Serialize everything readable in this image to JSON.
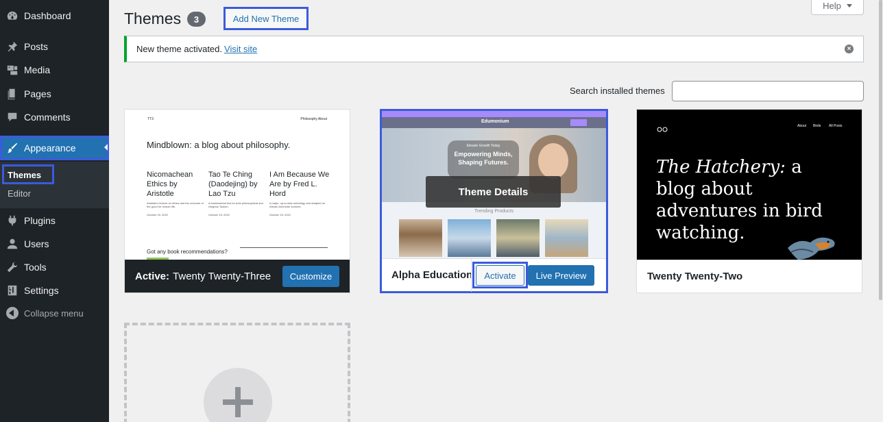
{
  "sidebar": {
    "items": [
      {
        "label": "Dashboard",
        "icon": "dashboard-icon"
      },
      {
        "label": "Posts",
        "icon": "pin-icon"
      },
      {
        "label": "Media",
        "icon": "media-icon"
      },
      {
        "label": "Pages",
        "icon": "pages-icon"
      },
      {
        "label": "Comments",
        "icon": "comment-icon"
      },
      {
        "label": "Appearance",
        "icon": "brush-icon"
      },
      {
        "label": "Plugins",
        "icon": "plug-icon"
      },
      {
        "label": "Users",
        "icon": "user-icon"
      },
      {
        "label": "Tools",
        "icon": "wrench-icon"
      },
      {
        "label": "Settings",
        "icon": "settings-icon"
      }
    ],
    "submenu": {
      "themes": "Themes",
      "editor": "Editor"
    },
    "collapse": "Collapse menu"
  },
  "header": {
    "title": "Themes",
    "count": "3",
    "add_new": "Add New Theme",
    "help": "Help"
  },
  "notice": {
    "text": "New theme activated.",
    "link": "Visit site"
  },
  "search": {
    "label": "Search installed themes",
    "value": ""
  },
  "themes": [
    {
      "name": "Twenty Twenty-Three",
      "active_label": "Active:",
      "action": "Customize",
      "preview": {
        "site": "TT3",
        "nav": "Philosophy  About",
        "headline": "Mindblown: a blog about philosophy.",
        "posts": [
          {
            "title": "Nicomachean Ethics by Aristotle",
            "excerpt": "Aristotle's lecture on ethics and the outcome of the good for human life.",
            "date": "October 15, 2022"
          },
          {
            "title": "Tao Te Ching (Daodejing) by Lao Tzu",
            "excerpt": "A fundamental text for both philosophical and religious Taoism.",
            "date": "October 15, 2022"
          },
          {
            "title": "I Am Because We Are by Fred L. Hord",
            "excerpt": "A major, up-to-date anthology and adapted on African American sources.",
            "date": "October 15, 2022"
          }
        ],
        "footer": "Got any book recommendations?"
      }
    },
    {
      "name": "Alpha Education",
      "overlay": "Theme Details",
      "activate": "Activate",
      "live_preview": "Live Preview",
      "preview": {
        "brand": "Edumonium",
        "tagline_small": "Elevate Growth Today",
        "hero": "Empowering Minds, Shaping Futures.",
        "section": "Trending Products"
      }
    },
    {
      "name": "Twenty Twenty-Two",
      "preview": {
        "nav": [
          "About",
          "Birds",
          "All Posts"
        ],
        "headline_italic": "The Hatchery:",
        "headline_rest": "a blog about adventures in bird watching."
      }
    }
  ],
  "colors": {
    "sidebar_bg": "#1d2327",
    "accent": "#2271b1",
    "highlight": "#3b5bdb",
    "notice_success": "#00a32a"
  }
}
